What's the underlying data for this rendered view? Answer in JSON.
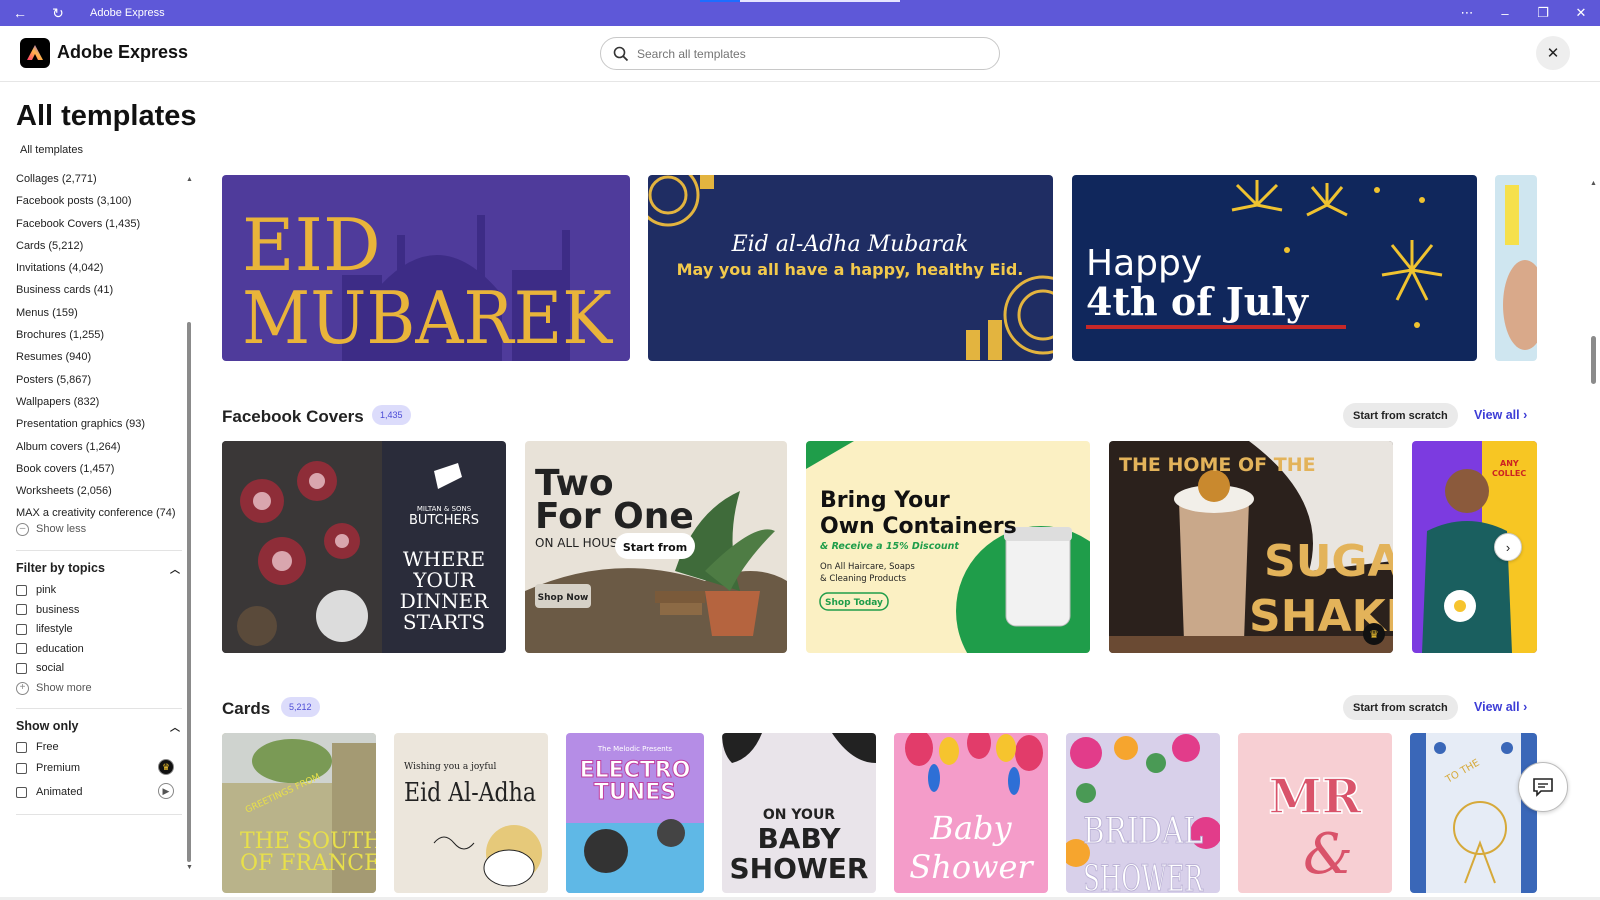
{
  "window": {
    "title": "Adobe Express",
    "back_icon": "←",
    "refresh_icon": "↻",
    "more_icon": "⋯",
    "minimize_icon": "–",
    "restore_icon": "❐",
    "close_icon": "✕"
  },
  "header": {
    "brand": "Adobe Express",
    "search_placeholder": "Search all templates"
  },
  "page": {
    "title": "All templates",
    "breadcrumb": "All templates"
  },
  "sidebar": {
    "categories": [
      "Collages (2,771)",
      "Facebook posts (3,100)",
      "Facebook Covers (1,435)",
      "Cards (5,212)",
      "Invitations (4,042)",
      "Business cards (41)",
      "Menus (159)",
      "Brochures (1,255)",
      "Resumes (940)",
      "Posters (5,867)",
      "Wallpapers (832)",
      "Presentation graphics (93)",
      "Album covers (1,264)",
      "Book covers (1,457)",
      "Worksheets (2,056)",
      "MAX a creativity conference (74)"
    ],
    "show_less": "Show less",
    "topics_heading": "Filter by topics",
    "topics": [
      "pink",
      "business",
      "lifestyle",
      "education",
      "social"
    ],
    "show_more": "Show more",
    "show_only_heading": "Show only",
    "show_only": [
      "Free",
      "Premium",
      "Animated"
    ]
  },
  "banners": {
    "eid": {
      "line1": "EID",
      "line2": "MUBAREK"
    },
    "eid_adha": {
      "script": "Eid al-Adha Mubarak",
      "sub": "May you all have a happy, healthy Eid."
    },
    "july": {
      "line1": "Happy",
      "line2": "4th of July"
    }
  },
  "facebook_covers": {
    "title": "Facebook Covers",
    "count": "1,435",
    "scratch": "Start from scratch",
    "view_all": "View all",
    "butchers": {
      "brand1": "MILTAN & SONS",
      "brand2": "BUTCHERS",
      "tag": [
        "WHERE",
        "YOUR",
        "DINNER",
        "STARTS"
      ]
    },
    "two_for_one": {
      "line1": "Two",
      "line2": "For One",
      "sub": "ON ALL HOUS",
      "overlay": "Start from",
      "shop": "Shop Now"
    },
    "containers": {
      "line1": "Bring Your",
      "line2": "Own Containers",
      "discount": "& Receive a 15% Discount",
      "body1": "On All Haircare, Soaps",
      "body2": "& Cleaning Products",
      "cta": "Shop Today"
    },
    "sugar": {
      "top": "THE HOME OF THE",
      "line1": "SUGAR",
      "line2": "SHAKE"
    },
    "party": {
      "tag1": "ANY",
      "tag2": "COLLEC"
    }
  },
  "cards": {
    "title": "Cards",
    "count": "5,212",
    "scratch": "Start from scratch",
    "view_all": "View all",
    "items": {
      "france": {
        "arc": "GREETINGS FROM",
        "line1": "THE SOUTH",
        "line2": "OF FRANCE"
      },
      "eid": {
        "top": "Wishing you a joyful",
        "main": "Eid Al-Adha"
      },
      "electro": {
        "top": "The Melodic Presents",
        "line1": "ELECTRO",
        "line2": "TUNES"
      },
      "baby_shower": {
        "line1": "ON YOUR",
        "line2": "BABY",
        "line3": "SHOWER"
      },
      "baby_script": {
        "line1": "Baby",
        "line2": "Shower"
      },
      "bridal": {
        "line1": "BRIDAL",
        "line2": "SHOWER"
      },
      "mr": {
        "line1": "MR",
        "line2": "&"
      },
      "bride": {
        "arc": "TO THE"
      }
    }
  },
  "colors": {
    "titlebar": "#5e58d8",
    "accent_link": "#3d3dd6",
    "badge_bg": "#dcdcfb"
  },
  "icons": {
    "search": "search-icon",
    "close": "close-icon",
    "chevron_up": "chevron-up-icon",
    "plus_circle": "plus-circle-icon",
    "minus_circle": "minus-circle-icon",
    "crown": "crown-icon",
    "play": "play-icon",
    "chat": "chat-icon",
    "arrow_right": "arrow-right-icon"
  }
}
